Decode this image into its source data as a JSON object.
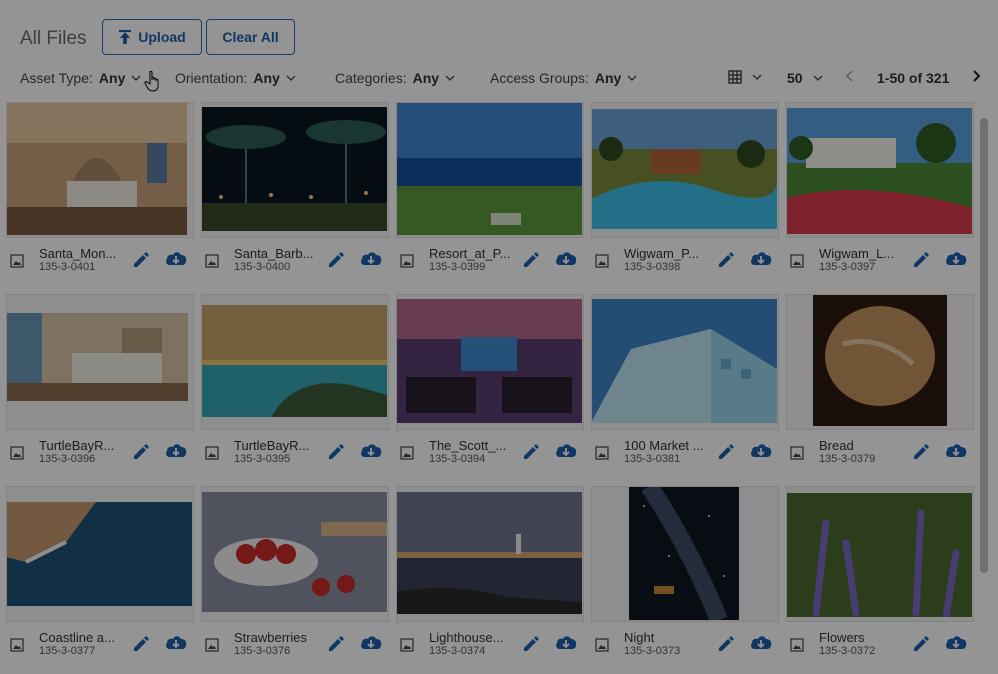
{
  "header": {
    "title": "All Files",
    "upload_label": "Upload",
    "clear_label": "Clear All"
  },
  "filters": [
    {
      "label": "Asset Type:",
      "value": "Any"
    },
    {
      "label": "Orientation:",
      "value": "Any"
    },
    {
      "label": "Categories:",
      "value": "Any"
    },
    {
      "label": "Access Groups:",
      "value": "Any"
    }
  ],
  "pagination": {
    "per_page": "50",
    "range": "1-50 of 321"
  },
  "colors": {
    "accent": "#1d5eab",
    "overlay": "rgba(0,0,0,0.42)"
  },
  "files": [
    {
      "name": "Santa_Mon...",
      "id": "135-3-0401",
      "icon": "bedroom-photo"
    },
    {
      "name": "Santa_Barb...",
      "id": "135-3-0400",
      "icon": "palm-night-photo"
    },
    {
      "name": "Resort_at_P...",
      "id": "135-3-0399",
      "icon": "golf-ocean-photo"
    },
    {
      "name": "Wigwam_P...",
      "id": "135-3-0398",
      "icon": "pool-photo"
    },
    {
      "name": "Wigwam_L...",
      "id": "135-3-0397",
      "icon": "garden-photo"
    },
    {
      "name": "TurtleBayR...",
      "id": "135-3-0396",
      "icon": "hotel-room-photo"
    },
    {
      "name": "TurtleBayR...",
      "id": "135-3-0395",
      "icon": "coast-sunset-photo"
    },
    {
      "name": "The_Scott_...",
      "id": "135-3-0394",
      "icon": "ballroom-photo"
    },
    {
      "name": "100 Market ...",
      "id": "135-3-0381",
      "icon": "building-photo"
    },
    {
      "name": "Bread",
      "id": "135-3-0379",
      "icon": "bread-photo"
    },
    {
      "name": "Coastline a...",
      "id": "135-3-0377",
      "icon": "coastline-photo"
    },
    {
      "name": "Strawberries",
      "id": "135-3-0376",
      "icon": "strawberries-photo"
    },
    {
      "name": "Lighthouse...",
      "id": "135-3-0374",
      "icon": "lighthouse-photo"
    },
    {
      "name": "Night",
      "id": "135-3-0373",
      "icon": "night-sky-photo"
    },
    {
      "name": "Flowers",
      "id": "135-3-0372",
      "icon": "lavender-photo"
    }
  ]
}
